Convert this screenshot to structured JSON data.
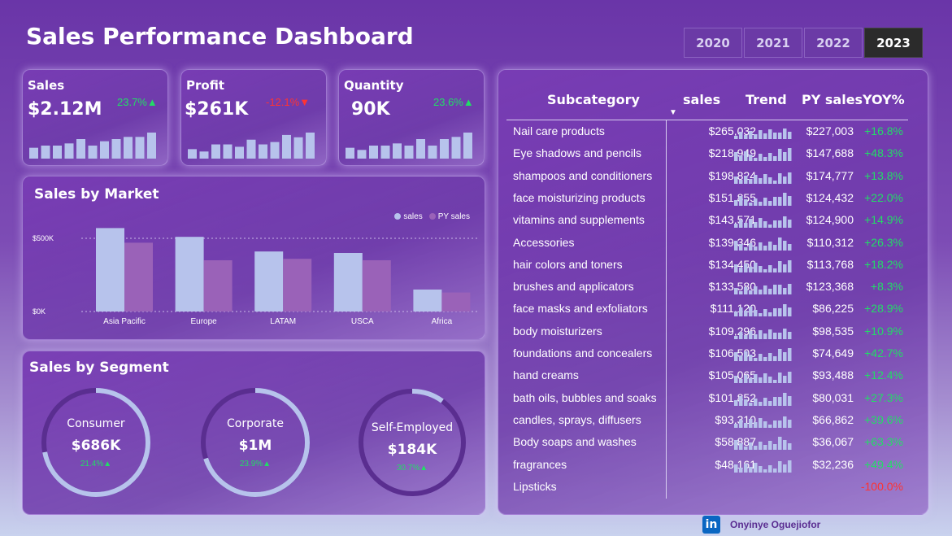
{
  "header": {
    "title": "Sales Performance Dashboard",
    "years": [
      "2020",
      "2021",
      "2022",
      "2023"
    ],
    "selected_year": "2023"
  },
  "kpis": {
    "sales": {
      "label": "Sales",
      "value": "$2.12M",
      "delta": "23.7%",
      "direction": "up",
      "bars": [
        5,
        6,
        6,
        7,
        9,
        6,
        8,
        9,
        10,
        10,
        12
      ]
    },
    "profit": {
      "label": "Profit",
      "value": "$261K",
      "delta": "-12.1%",
      "direction": "down",
      "bars": [
        4,
        3,
        6,
        6,
        5,
        8,
        6,
        7,
        10,
        9,
        11
      ]
    },
    "quantity": {
      "label": "Quantity",
      "value": "90K",
      "delta": "23.6%",
      "direction": "up",
      "bars": [
        5,
        4,
        6,
        6,
        7,
        6,
        9,
        6,
        9,
        10,
        12
      ]
    }
  },
  "market": {
    "title": "Sales by Market",
    "legend": [
      "sales",
      "PY sales"
    ],
    "colors": {
      "sales": "#b7c3ec",
      "py": "#9a62b8"
    }
  },
  "chart_data": {
    "type": "bar",
    "categories": [
      "Asia Pacific",
      "Europe",
      "LATAM",
      "USCA",
      "Africa"
    ],
    "series": [
      {
        "name": "sales",
        "values": [
          570,
          510,
          410,
          400,
          150
        ]
      },
      {
        "name": "PY sales",
        "values": [
          470,
          350,
          360,
          350,
          130
        ]
      }
    ],
    "yticks": [
      "$0K",
      "$500K"
    ],
    "ylim": [
      0,
      700
    ]
  },
  "segments": {
    "title": "Sales by Segment",
    "items": [
      {
        "name": "Consumer",
        "value": "$686K",
        "delta": "21.4%",
        "ring": 0.72
      },
      {
        "name": "Corporate",
        "value": "$1M",
        "delta": "23.9%",
        "ring": 0.7
      },
      {
        "name": "Self-Employed",
        "value": "$184K",
        "delta": "30.7%",
        "ring": 0.1
      }
    ],
    "colors": {
      "track": "#5a2e90",
      "fill": "#b7c3ec"
    }
  },
  "table": {
    "headers": {
      "subcategory": "Subcategory",
      "sales": "sales",
      "trend": "Trend",
      "py": "PY sales",
      "yoy": "YOY%"
    },
    "rows": [
      {
        "name": "Nail care products",
        "sales": "$265,032",
        "py": "$227,003",
        "yoy": "+16.8%",
        "pos": true
      },
      {
        "name": "Eye shadows and pencils",
        "sales": "$218,949",
        "py": "$147,688",
        "yoy": "+48.3%",
        "pos": true
      },
      {
        "name": "shampoos and conditioners",
        "sales": "$198,824",
        "py": "$174,777",
        "yoy": "+13.8%",
        "pos": true
      },
      {
        "name": "face moisturizing products",
        "sales": "$151,855",
        "py": "$124,432",
        "yoy": "+22.0%",
        "pos": true
      },
      {
        "name": "vitamins and supplements",
        "sales": "$143,571",
        "py": "$124,900",
        "yoy": "+14.9%",
        "pos": true
      },
      {
        "name": "Accessories",
        "sales": "$139,346",
        "py": "$110,312",
        "yoy": "+26.3%",
        "pos": true
      },
      {
        "name": "hair colors and toners",
        "sales": "$134,450",
        "py": "$113,768",
        "yoy": "+18.2%",
        "pos": true
      },
      {
        "name": "brushes and applicators",
        "sales": "$133,580",
        "py": "$123,368",
        "yoy": "+8.3%",
        "pos": true
      },
      {
        "name": "face masks and exfoliators",
        "sales": "$111,120",
        "py": "$86,225",
        "yoy": "+28.9%",
        "pos": true
      },
      {
        "name": "body moisturizers",
        "sales": "$109,296",
        "py": "$98,535",
        "yoy": "+10.9%",
        "pos": true
      },
      {
        "name": "foundations and concealers",
        "sales": "$106,503",
        "py": "$74,649",
        "yoy": "+42.7%",
        "pos": true
      },
      {
        "name": "hand creams",
        "sales": "$105,065",
        "py": "$93,488",
        "yoy": "+12.4%",
        "pos": true
      },
      {
        "name": "bath oils, bubbles and soaks",
        "sales": "$101,852",
        "py": "$80,031",
        "yoy": "+27.3%",
        "pos": true
      },
      {
        "name": "candles, sprays, diffusers",
        "sales": "$93,310",
        "py": "$66,862",
        "yoy": "+39.6%",
        "pos": true
      },
      {
        "name": "Body soaps and washes",
        "sales": "$58,887",
        "py": "$36,067",
        "yoy": "+63.3%",
        "pos": true
      },
      {
        "name": "fragrances",
        "sales": "$48,161",
        "py": "$32,236",
        "yoy": "+49.4%",
        "pos": true
      },
      {
        "name": "Lipsticks",
        "sales": "",
        "py": "",
        "yoy": "-100.0%",
        "pos": false
      }
    ]
  },
  "footer": {
    "icon": "in",
    "author": "Onyinye Oguejiofor"
  }
}
